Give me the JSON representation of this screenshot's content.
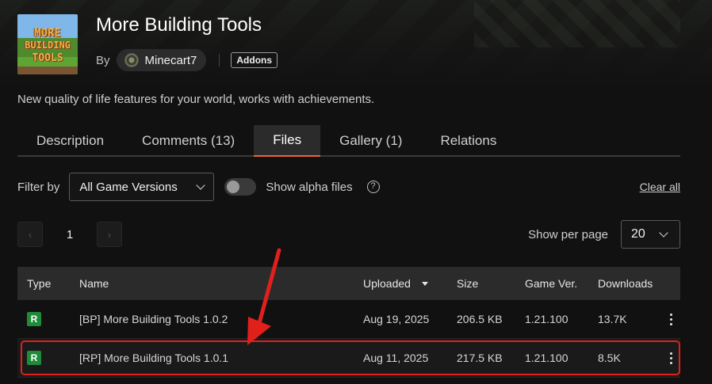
{
  "project": {
    "title": "More Building Tools",
    "by_label": "By",
    "author": "Minecart7",
    "category": "Addons",
    "summary": "New quality of life features for your world, works with achievements.",
    "logo_words": [
      "MORE",
      "BUILDING",
      "TOOLS"
    ]
  },
  "tabs": [
    {
      "label": "Description",
      "active": false
    },
    {
      "label": "Comments (13)",
      "active": false
    },
    {
      "label": "Files",
      "active": true
    },
    {
      "label": "Gallery (1)",
      "active": false
    },
    {
      "label": "Relations",
      "active": false
    }
  ],
  "filters": {
    "filter_label": "Filter by",
    "version_select": "All Game Versions",
    "alpha_toggle_label": "Show alpha files",
    "alpha_toggle_on": false,
    "clear_all": "Clear all"
  },
  "pagination": {
    "current_page": "1",
    "per_page_label": "Show per page",
    "per_page_value": "20"
  },
  "table": {
    "headers": {
      "type": "Type",
      "name": "Name",
      "uploaded": "Uploaded",
      "size": "Size",
      "game_ver": "Game Ver.",
      "downloads": "Downloads"
    },
    "rows": [
      {
        "type": "R",
        "name": "[BP] More Building Tools 1.0.2",
        "uploaded": "Aug 19, 2025",
        "size": "206.5 KB",
        "game_ver": "1.21.100",
        "downloads": "13.7K"
      },
      {
        "type": "R",
        "name": "[RP] More Building Tools 1.0.1",
        "uploaded": "Aug 11, 2025",
        "size": "217.5 KB",
        "game_ver": "1.21.100",
        "downloads": "8.5K"
      }
    ]
  },
  "colors": {
    "accent": "#f16436",
    "release_badge": "#1f8a3a",
    "annotation": "#e0201a"
  }
}
